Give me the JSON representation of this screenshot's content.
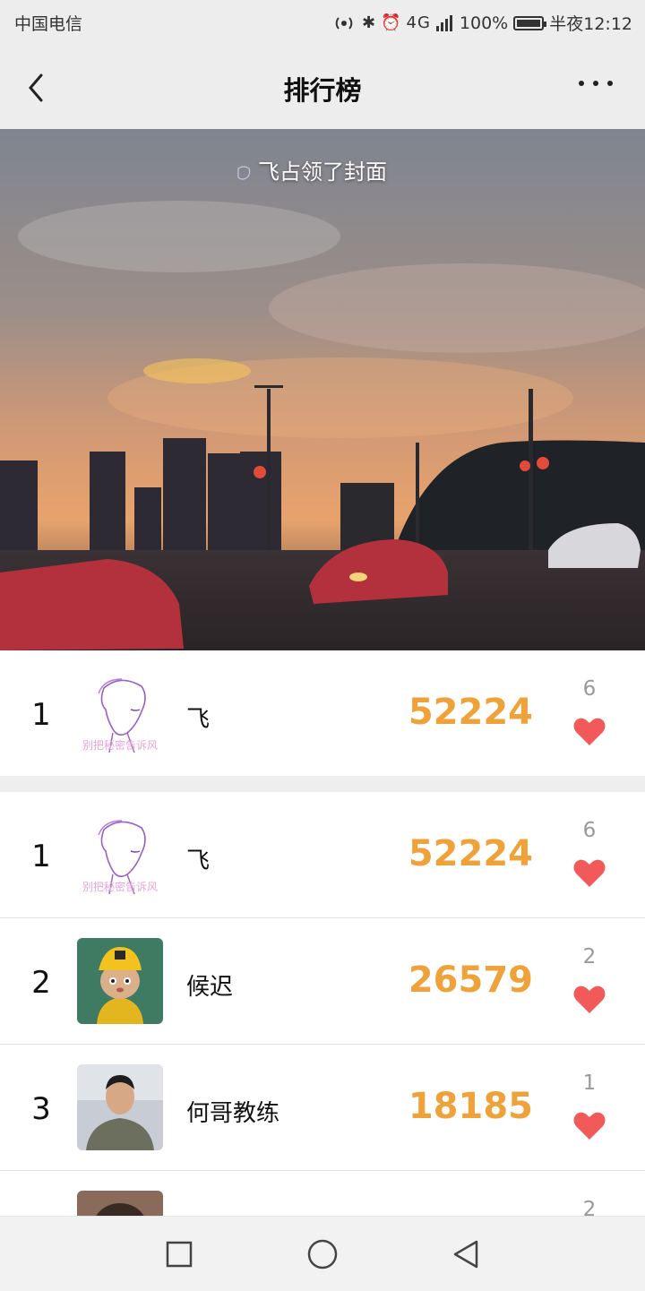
{
  "status_bar": {
    "carrier": "中国电信",
    "network": "4G",
    "battery": "100%",
    "time": "半夜12:12"
  },
  "header": {
    "title": "排行榜",
    "back_icon": "chevron-left-icon",
    "more_icon": "more-horizontal-icon"
  },
  "cover": {
    "caption": "飞占领了封面",
    "photo_description": "sunset sky over city street with cars"
  },
  "my_rank": {
    "rank": "1",
    "name": "飞",
    "steps": "52224",
    "likes": "6",
    "avatar_text": "别把秘密告诉风"
  },
  "ranking": [
    {
      "rank": "1",
      "name": "飞",
      "steps": "52224",
      "likes": "6",
      "avatar_text": "别把秘密告诉风"
    },
    {
      "rank": "2",
      "name": "候迟",
      "steps": "26579",
      "likes": "2"
    },
    {
      "rank": "3",
      "name": "何哥教练",
      "steps": "18185",
      "likes": "1"
    },
    {
      "rank": "",
      "name": "",
      "steps": "",
      "likes": "2"
    }
  ],
  "colors": {
    "steps": "#f0a23a",
    "heart": "#f25a5a",
    "header_bg": "#ededed"
  },
  "system_nav": [
    "square-icon",
    "circle-icon",
    "triangle-back-icon"
  ]
}
